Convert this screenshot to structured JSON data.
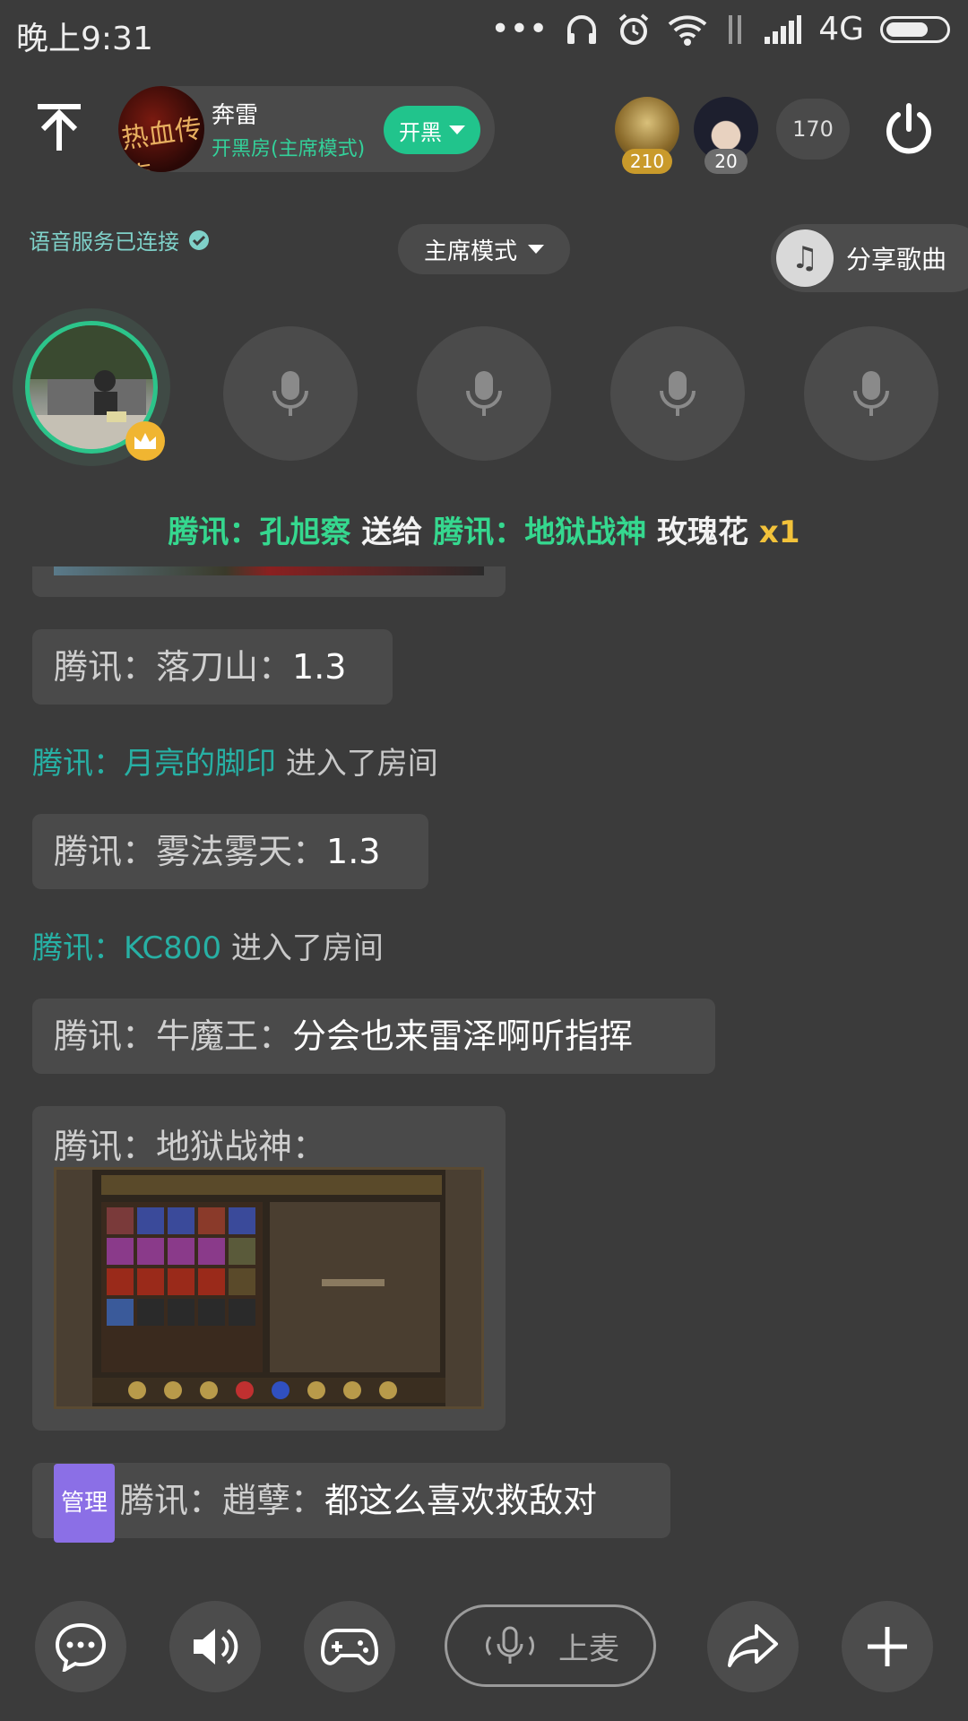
{
  "status_bar": {
    "time": "晚上9:31",
    "dots": "•••",
    "network": "4G"
  },
  "header": {
    "room_name": "奔雷",
    "room_mode": "开黑房(主席模式)",
    "logo_text": "热血传奇",
    "kaihei_label": "开黑",
    "viewer_badges": [
      "210",
      "20"
    ],
    "online_count": "170"
  },
  "toolbar": {
    "voice_status": "语音服务已连接",
    "mode_label": "主席模式",
    "share_label": "分享歌曲"
  },
  "gift_banner": {
    "sender": "腾讯：孔旭察",
    "verb": "送给",
    "receiver": "腾讯：地狱战神",
    "gift": "玫瑰花",
    "count": "x1"
  },
  "chat": {
    "m1_user": "腾讯：落刀山：",
    "m1_text": "1.3",
    "s1_user": "腾讯：月亮的脚印",
    "s1_text": "进入了房间",
    "m2_user": "腾讯：雾法雾天：",
    "m2_text": "1.3",
    "s2_user": "腾讯：KC800",
    "s2_text": "进入了房间",
    "m3_user": "腾讯：牛魔王：",
    "m3_text": "分会也来雷泽啊听指挥",
    "m4_user": "腾讯：地狱战神：",
    "m5_tag": "管理",
    "m5_user": "腾讯：趙孽：",
    "m5_text": "都这么喜欢救敌对"
  },
  "bottom_bar": {
    "mic_label": "上麦"
  },
  "colors": {
    "background": "#3b3b3b",
    "accent_green": "#21c48c",
    "system_name": "#27b0a4",
    "gift_gold": "#f2c23a",
    "admin_tag": "#8b6fe6"
  }
}
